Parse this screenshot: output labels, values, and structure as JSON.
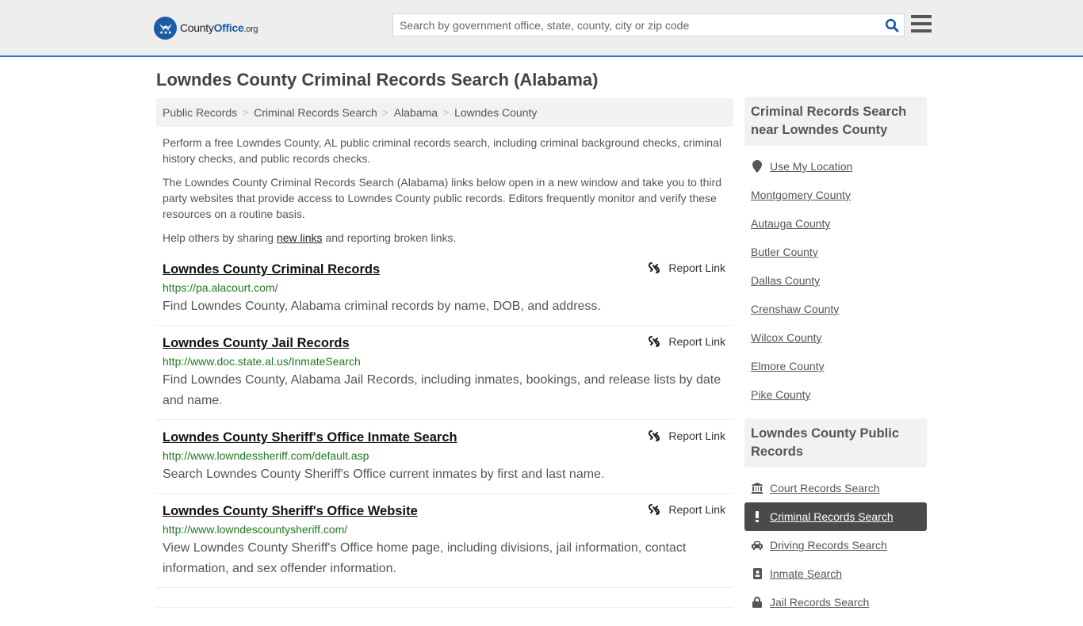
{
  "header": {
    "logo": {
      "county": "County",
      "office": "Office",
      "org": ".org"
    },
    "search": {
      "placeholder": "Search by government office, state, county, city or zip code",
      "value": ""
    }
  },
  "colors": {
    "brand_blue": "#1c5aa3",
    "header_rule": "#2e78b7",
    "url_green": "#1f7a1f",
    "active_bg": "#4a4a4a"
  },
  "page": {
    "title": "Lowndes County Criminal Records Search (Alabama)"
  },
  "breadcrumb": [
    {
      "label": "Public Records"
    },
    {
      "label": "Criminal Records Search"
    },
    {
      "label": "Alabama"
    },
    {
      "label": "Lowndes County"
    }
  ],
  "intro": {
    "p1": "Perform a free Lowndes County, AL public criminal records search, including criminal background checks, criminal history checks, and public records checks.",
    "p2": "The Lowndes County Criminal Records Search (Alabama) links below open in a new window and take you to third party websites that provide access to Lowndes County public records. Editors frequently monitor and verify these resources on a routine basis.",
    "p3_before": "Help others by sharing ",
    "p3_link": "new links",
    "p3_after": " and reporting broken links."
  },
  "report_label": "Report Link",
  "results": [
    {
      "title": "Lowndes County Criminal Records",
      "url": "https://pa.alacourt.com/",
      "description": "Find Lowndes County, Alabama criminal records by name, DOB, and address."
    },
    {
      "title": "Lowndes County Jail Records",
      "url": "http://www.doc.state.al.us/InmateSearch",
      "description": "Find Lowndes County, Alabama Jail Records, including inmates, bookings, and release lists by date and name."
    },
    {
      "title": "Lowndes County Sheriff's Office Inmate Search",
      "url": "http://www.lowndessheriff.com/default.asp",
      "description": "Search Lowndes County Sheriff's Office current inmates by first and last name."
    },
    {
      "title": "Lowndes County Sheriff's Office Website",
      "url": "http://www.lowndescountysheriff.com/",
      "description": "View Lowndes County Sheriff's Office home page, including divisions, jail information, contact information, and sex offender information."
    }
  ],
  "sidebar": {
    "nearby": {
      "heading": "Criminal Records Search near Lowndes County",
      "use_location": "Use My Location",
      "counties": [
        "Montgomery County",
        "Autauga County",
        "Butler County",
        "Dallas County",
        "Crenshaw County",
        "Wilcox County",
        "Elmore County",
        "Pike County"
      ]
    },
    "public_records": {
      "heading": "Lowndes County Public Records",
      "items": [
        {
          "label": "Court Records Search",
          "icon": "bank-icon",
          "active": false
        },
        {
          "label": "Criminal Records Search",
          "icon": "exclamation-icon",
          "active": true
        },
        {
          "label": "Driving Records Search",
          "icon": "car-icon",
          "active": false
        },
        {
          "label": "Inmate Search",
          "icon": "id-badge-icon",
          "active": false
        },
        {
          "label": "Jail Records Search",
          "icon": "lock-icon",
          "active": false
        }
      ]
    }
  }
}
